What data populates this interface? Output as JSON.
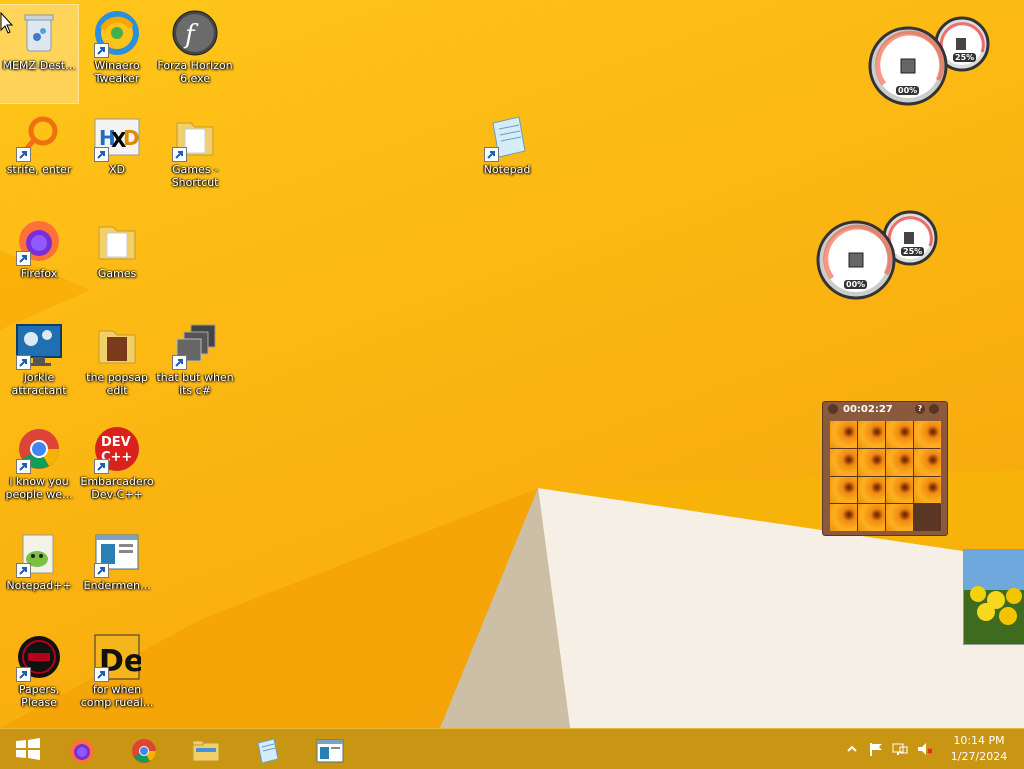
{
  "desktop": {
    "icons": [
      {
        "label": "MEMZ-Dest...",
        "icon": "recycle-bin-icon"
      },
      {
        "label": "Winaero Tweaker",
        "icon": "winaero-tweaker-icon"
      },
      {
        "label": "Forza Horizon 6.exe",
        "icon": "flash-icon"
      },
      {
        "label": "strife, enter",
        "icon": "search-app-icon"
      },
      {
        "label": "XD",
        "icon": "hxd-icon"
      },
      {
        "label": "Games - Shortcut",
        "icon": "folder-icon"
      },
      {
        "label": "Notepad",
        "icon": "notepad-icon"
      },
      {
        "label": "Firefox",
        "icon": "firefox-icon"
      },
      {
        "label": "Games",
        "icon": "folder-icon"
      },
      {
        "label": "jorkle attractant",
        "icon": "settings-monitor-icon"
      },
      {
        "label": "the popsap edit",
        "icon": "folder-icon"
      },
      {
        "label": "that but when its c#",
        "icon": "windows-stack-icon"
      },
      {
        "label": "i know you people we...",
        "icon": "chrome-icon"
      },
      {
        "label": "Embarcadero Dev-C++",
        "icon": "devcpp-icon"
      },
      {
        "label": "Notepad++",
        "icon": "notepadpp-icon"
      },
      {
        "label": "Endermen...",
        "icon": "window-app-icon"
      },
      {
        "label": "Papers, Please",
        "icon": "papers-please-icon"
      },
      {
        "label": "for when comp rueal...",
        "icon": "de-icon"
      }
    ]
  },
  "gadgets": {
    "cpu_meter_1": {
      "cpu": "00%",
      "memory": "25%"
    },
    "cpu_meter_2": {
      "cpu": "00%",
      "memory": "25%"
    },
    "puzzle": {
      "timer": "00:02:27",
      "help": "?"
    }
  },
  "taskbar": {
    "start_label": "Start",
    "apps": [
      {
        "icon": "firefox-icon"
      },
      {
        "icon": "chrome-icon"
      },
      {
        "icon": "file-explorer-icon"
      },
      {
        "icon": "notepad-icon"
      },
      {
        "icon": "window-app-icon"
      }
    ],
    "clock": {
      "time": "10:14 PM",
      "date": "1/27/2024"
    }
  }
}
